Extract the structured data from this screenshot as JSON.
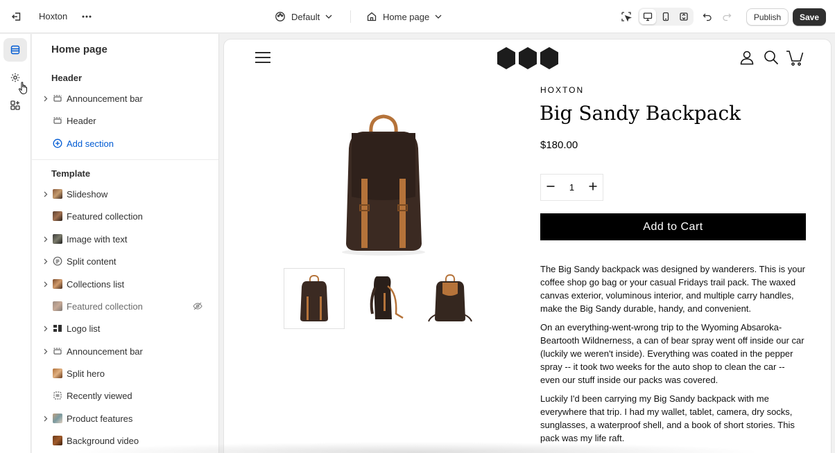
{
  "topbar": {
    "store_name": "Hoxton",
    "theme_label": "Default",
    "page_label": "Home page",
    "publish_label": "Publish",
    "save_label": "Save"
  },
  "sidebar": {
    "title": "Home page",
    "header_group": {
      "title": "Header",
      "items": [
        {
          "label": "Announcement bar",
          "expandable": true,
          "icon": "layout-section-icon"
        },
        {
          "label": "Header",
          "expandable": false,
          "icon": "layout-section-icon"
        },
        {
          "label": "Add section",
          "expandable": false,
          "icon": "add-circle-icon"
        }
      ]
    },
    "template_group": {
      "title": "Template",
      "items": [
        {
          "label": "Slideshow",
          "expandable": true
        },
        {
          "label": "Featured collection",
          "expandable": false
        },
        {
          "label": "Image with text",
          "expandable": true
        },
        {
          "label": "Split content",
          "expandable": true
        },
        {
          "label": "Collections list",
          "expandable": true
        },
        {
          "label": "Featured collection",
          "expandable": false,
          "hidden": true
        },
        {
          "label": "Logo list",
          "expandable": true
        },
        {
          "label": "Announcement bar",
          "expandable": true
        },
        {
          "label": "Split hero",
          "expandable": false
        },
        {
          "label": "Recently viewed",
          "expandable": false
        },
        {
          "label": "Product features",
          "expandable": true
        },
        {
          "label": "Background video",
          "expandable": false
        }
      ]
    }
  },
  "preview": {
    "vendor": "HOXTON",
    "product_title": "Big Sandy Backpack",
    "price": "$180.00",
    "quantity": "1",
    "add_to_cart": "Add to Cart",
    "description": [
      "The Big Sandy backpack was designed by wanderers. This is your coffee shop go bag or your casual Fridays trail pack. The waxed canvas exterior, voluminous interior, and multiple carry handles, make the Big Sandy durable, handy, and convenient.",
      "On an everything-went-wrong trip to the Wyoming Absaroka-Beartooth Wildnerness, a can of bear spray went off inside our car (luckily we weren't inside). Everything was coated in the pepper spray -- it took two weeks for the auto shop to clean the car -- even our stuff inside our packs was covered.",
      "Luckily I'd been carrying my Big Sandy backpack with me everywhere that trip. I had my wallet, tablet, camera, dry socks, sunglasses, a waterproof shell, and a book of short stories. This pack was my life raft."
    ]
  },
  "colors": {
    "accent_link": "#005bd3",
    "save_bg": "#303030",
    "atc_bg": "#000000",
    "backpack_brown": "#3b2a22",
    "strap_tan": "#b5733a"
  }
}
